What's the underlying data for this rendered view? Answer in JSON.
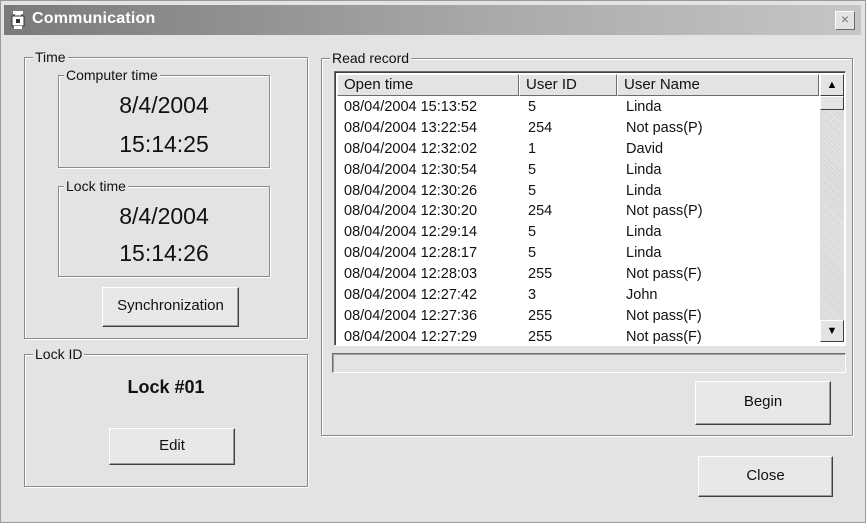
{
  "window": {
    "title": "Communication",
    "close_glyph": "×",
    "icon": "lock-app-icon"
  },
  "time": {
    "label": "Time",
    "computer": {
      "label": "Computer time",
      "date": "8/4/2004",
      "time": "15:14:25"
    },
    "lock": {
      "label": "Lock time",
      "date": "8/4/2004",
      "time": "15:14:26"
    },
    "sync_label": "Synchronization"
  },
  "lock_id": {
    "label": "Lock ID",
    "name": "Lock #01",
    "edit_label": "Edit"
  },
  "read_record": {
    "label": "Read record",
    "columns": [
      "Open time",
      "User ID",
      "User Name"
    ],
    "rows": [
      [
        "08/04/2004 15:13:52",
        "5",
        "Linda"
      ],
      [
        "08/04/2004 13:22:54",
        "254",
        "Not pass(P)"
      ],
      [
        "08/04/2004 12:32:02",
        "1",
        "David"
      ],
      [
        "08/04/2004 12:30:54",
        "5",
        "Linda"
      ],
      [
        "08/04/2004 12:30:26",
        "5",
        "Linda"
      ],
      [
        "08/04/2004 12:30:20",
        "254",
        "Not pass(P)"
      ],
      [
        "08/04/2004 12:29:14",
        "5",
        "Linda"
      ],
      [
        "08/04/2004 12:28:17",
        "5",
        "Linda"
      ],
      [
        "08/04/2004 12:28:03",
        "255",
        "Not pass(F)"
      ],
      [
        "08/04/2004 12:27:42",
        "3",
        "John"
      ],
      [
        "08/04/2004 12:27:36",
        "255",
        "Not pass(F)"
      ],
      [
        "08/04/2004 12:27:29",
        "255",
        "Not pass(F)"
      ]
    ],
    "progress": 0,
    "begin_label": "Begin"
  },
  "close_label": "Close"
}
